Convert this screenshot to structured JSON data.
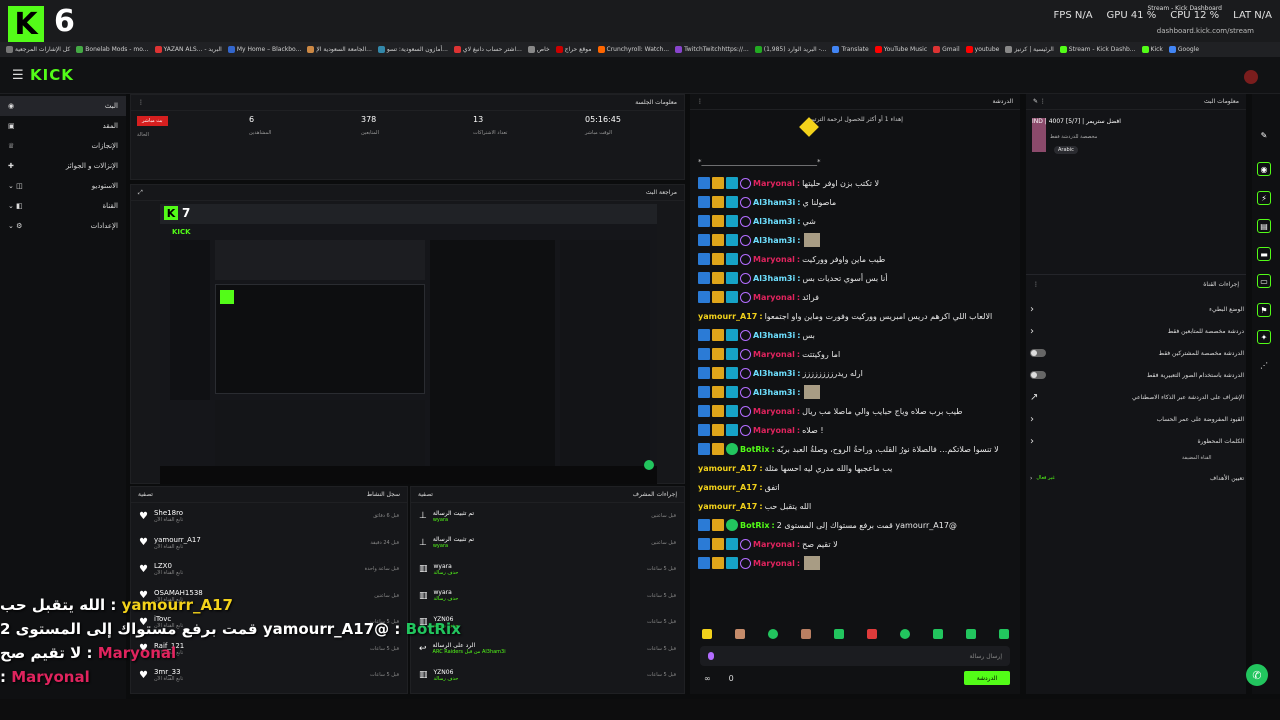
{
  "browser": {
    "tab_title": "Stream - Kick Dashboard",
    "url": "dashboard.kick.com/stream",
    "bookmarks": [
      "كل الإشارات المرجعية",
      "Bonelab Mods - mo...",
      "YAZAN ALS... - البريد",
      "My Home – Blackbo...",
      "الجامعة السعودية الإ...",
      "أمازون السعودية: تسو...",
      "اشتر حساب دانبغ لاي...",
      "خاص",
      "موقع حراج",
      "Crunchyroll: Watch...",
      "TwitchTwitchhttps://...",
      "(1,985) البريد الوارد -...",
      "Translate",
      "YouTube Music",
      "Gmail",
      "youtube",
      "الرئيسية | كرنيز",
      "Stream - Kick Dashb...",
      "Kick",
      "Google"
    ]
  },
  "overlay_stats": {
    "logo": "K",
    "stream_number": "6",
    "fps": "FPS  N/A",
    "gpu": "GPU 41 %",
    "cpu": "CPU 12 %",
    "lat": "LAT N/A"
  },
  "header": {
    "brand": "KICK"
  },
  "sidebar": {
    "items": [
      {
        "label": "البث",
        "active": true
      },
      {
        "label": "المقد",
        "active": false
      },
      {
        "label": "الإنجازات",
        "active": false
      },
      {
        "label": "الإنزالات و الجوائز",
        "active": false
      },
      {
        "label": "الاستوديو",
        "active": false
      },
      {
        "label": "القناة",
        "active": false
      },
      {
        "label": "الإعدادات",
        "active": false
      }
    ]
  },
  "session": {
    "title": "معلومات الجلسة",
    "live_badge": "بث مباشر",
    "live_label": "الحالة",
    "viewers_value": "6",
    "viewers_label": "المشاهدين",
    "followers_value": "378",
    "followers_label": "المتابعين",
    "subs_value": "13",
    "subs_label": "تعداد الاشتراكات",
    "time_value": "05:16:45",
    "time_label": "الوقت مباشر"
  },
  "preview": {
    "title": "مراجعة البث",
    "overlay_number": "7",
    "brand": "KICK"
  },
  "activity": {
    "title": "سجل النشاط",
    "filter": "تصفية",
    "items": [
      {
        "name": "She18ro",
        "sub": "تابع القناة الآن",
        "time": "قبل 6 دقائق"
      },
      {
        "name": "yamourr_A17",
        "sub": "تابع القناة الآن",
        "time": "قبل 24 دقيقة"
      },
      {
        "name": "LZX0",
        "sub": "تابع القناة الآن",
        "time": "قبل ساعة واحدة"
      },
      {
        "name": "OSAMAH1538",
        "sub": "تابع القناة الآن",
        "time": "قبل ساعتين"
      },
      {
        "name": "iTovc",
        "sub": "تابع القناة الآن",
        "time": "قبل 5 ساعات"
      },
      {
        "name": "Raif_121",
        "sub": "تابع القناة الآن",
        "time": "قبل 5 ساعات"
      },
      {
        "name": "3mr_33",
        "sub": "تابع القناة الآن",
        "time": "قبل 5 ساعات"
      }
    ]
  },
  "mod_actions": {
    "title": "إجراءات المشرف",
    "filter": "تصفية",
    "items": [
      {
        "action": "تم تثبيت الرسالة",
        "by": "wyara",
        "time": "قبل ساعتين"
      },
      {
        "action": "تم تثبيت الرسالة",
        "by": "wyara",
        "time": "قبل ساعتين"
      },
      {
        "action": "wyara",
        "by": "حذف رسالة",
        "time": "قبل 5 ساعات"
      },
      {
        "action": "wyara",
        "by": "حذف رسالة",
        "time": "قبل 5 ساعات"
      },
      {
        "action": "YZN06",
        "by": "حذف رسالة",
        "time": "قبل 5 ساعات"
      },
      {
        "action": "الرد على الرسالة",
        "by": "ARC Raiders من قبل Al3ham3i",
        "time": "قبل 5 ساعات"
      },
      {
        "action": "YZN06",
        "by": "حذف رسالة",
        "time": "قبل 5 ساعات"
      }
    ]
  },
  "chat": {
    "title": "الدردشة",
    "pinned": "إهداء 1 أو أكثر للحصول لرحمة الترتيب",
    "divider": "*_________________________________*",
    "messages": [
      {
        "user": "Maryonal",
        "color": "red",
        "text": "لا تكتب بزن اوفر حليتها"
      },
      {
        "user": "Al3ham3i",
        "color": "cyan",
        "text": "ماصولنا ي"
      },
      {
        "user": "Al3ham3i",
        "color": "cyan",
        "text": "شي"
      },
      {
        "user": "Al3ham3i",
        "color": "cyan",
        "text": ""
      },
      {
        "user": "Maryonal",
        "color": "red",
        "text": "طيب ماين واوفر ووركيت"
      },
      {
        "user": "Al3ham3i",
        "color": "cyan",
        "text": "أنا بس أسوي تحديات بس"
      },
      {
        "user": "Maryonal",
        "color": "red",
        "text": "فرائد"
      },
      {
        "user": "yamourr_A17",
        "color": "yellow",
        "text": "الالعاب اللي اكرهم دريس امبريس ووركيت وفورت وماين واو اجتمعوا"
      },
      {
        "user": "Al3ham3i",
        "color": "cyan",
        "text": "بس"
      },
      {
        "user": "Maryonal",
        "color": "red",
        "text": "اما روكيتتت"
      },
      {
        "user": "Al3ham3i",
        "color": "cyan",
        "text": "ارله ريدرزززززززز"
      },
      {
        "user": "Al3ham3i",
        "color": "cyan",
        "text": ""
      },
      {
        "user": "Maryonal",
        "color": "red",
        "text": "طيب برب صلاه وياج حبايب والي ماصلا مب ريال"
      },
      {
        "user": "Maryonal",
        "color": "red",
        "text": "صلاه !"
      },
      {
        "user": "BotRix",
        "color": "green",
        "text": "لا تنسوا صلاتكم… فالصلاة نورُ القلب، وراحةُ الروح، وصلةُ العبد بربّه"
      },
      {
        "user": "yamourr_A17",
        "color": "yellow",
        "text": "يب ماعجبها والله مدري ليه احسها مثلة"
      },
      {
        "user": "yamourr_A17",
        "color": "yellow",
        "text": "اتفق"
      },
      {
        "user": "yamourr_A17",
        "color": "yellow",
        "text": "الله يتقبل حب"
      },
      {
        "user": "BotRix",
        "color": "green",
        "text": "قمت برفع مستواك إلى المستوى 2 yamourr_A17@"
      },
      {
        "user": "Maryonal",
        "color": "red",
        "text": "لا تقيم صح"
      },
      {
        "user": "Maryonal",
        "color": "red",
        "text": ""
      }
    ],
    "input_placeholder": "إرسال رسالة",
    "send_label": "الدردشة",
    "viewer_count": "0"
  },
  "stream_info": {
    "title": "معلومات البث",
    "stream_title": "IND | 4007 [5/7] | افضل ستريمر",
    "category": "مخصصة للدردشة فقط",
    "tag": "Arabic"
  },
  "channel_actions": {
    "title": "إجراءات القناة",
    "rows": [
      {
        "label": "الوضع البطيء",
        "control": "chevron"
      },
      {
        "label": "دردشة مخصصة للمتابعين فقط",
        "control": "chevron"
      },
      {
        "label": "الدردشة مخصصة للمشتركين فقط",
        "control": "toggle"
      },
      {
        "label": "الدردشة باستخدام الصور التعبيرية فقط",
        "control": "toggle"
      },
      {
        "label": "الإشراف على الدردشة عبر الذكاء الاصطناعي",
        "control": "link"
      },
      {
        "label": "القيود المفروضة على عمر الحساب",
        "control": "chevron"
      },
      {
        "label": "الكلمات المحظورة",
        "control": "chevron"
      }
    ],
    "extra_label": "القناة المضيفة",
    "goal_label": "تعيين الأهداف",
    "goal_value": "غير فعال"
  },
  "overlay_chat": [
    {
      "user": "yamourr_A17",
      "text": "الله يتقبل حب"
    },
    {
      "user": "BotRix",
      "text": "قمت برفع مستواك إلى المستوى 2 yamourr_A17@"
    },
    {
      "user": "Maryonal",
      "text": "لا تقيم صح"
    },
    {
      "user": "Maryonal",
      "text": ""
    }
  ],
  "colors": {
    "kick_green": "#53fc18",
    "live_red": "#d61f1f"
  }
}
